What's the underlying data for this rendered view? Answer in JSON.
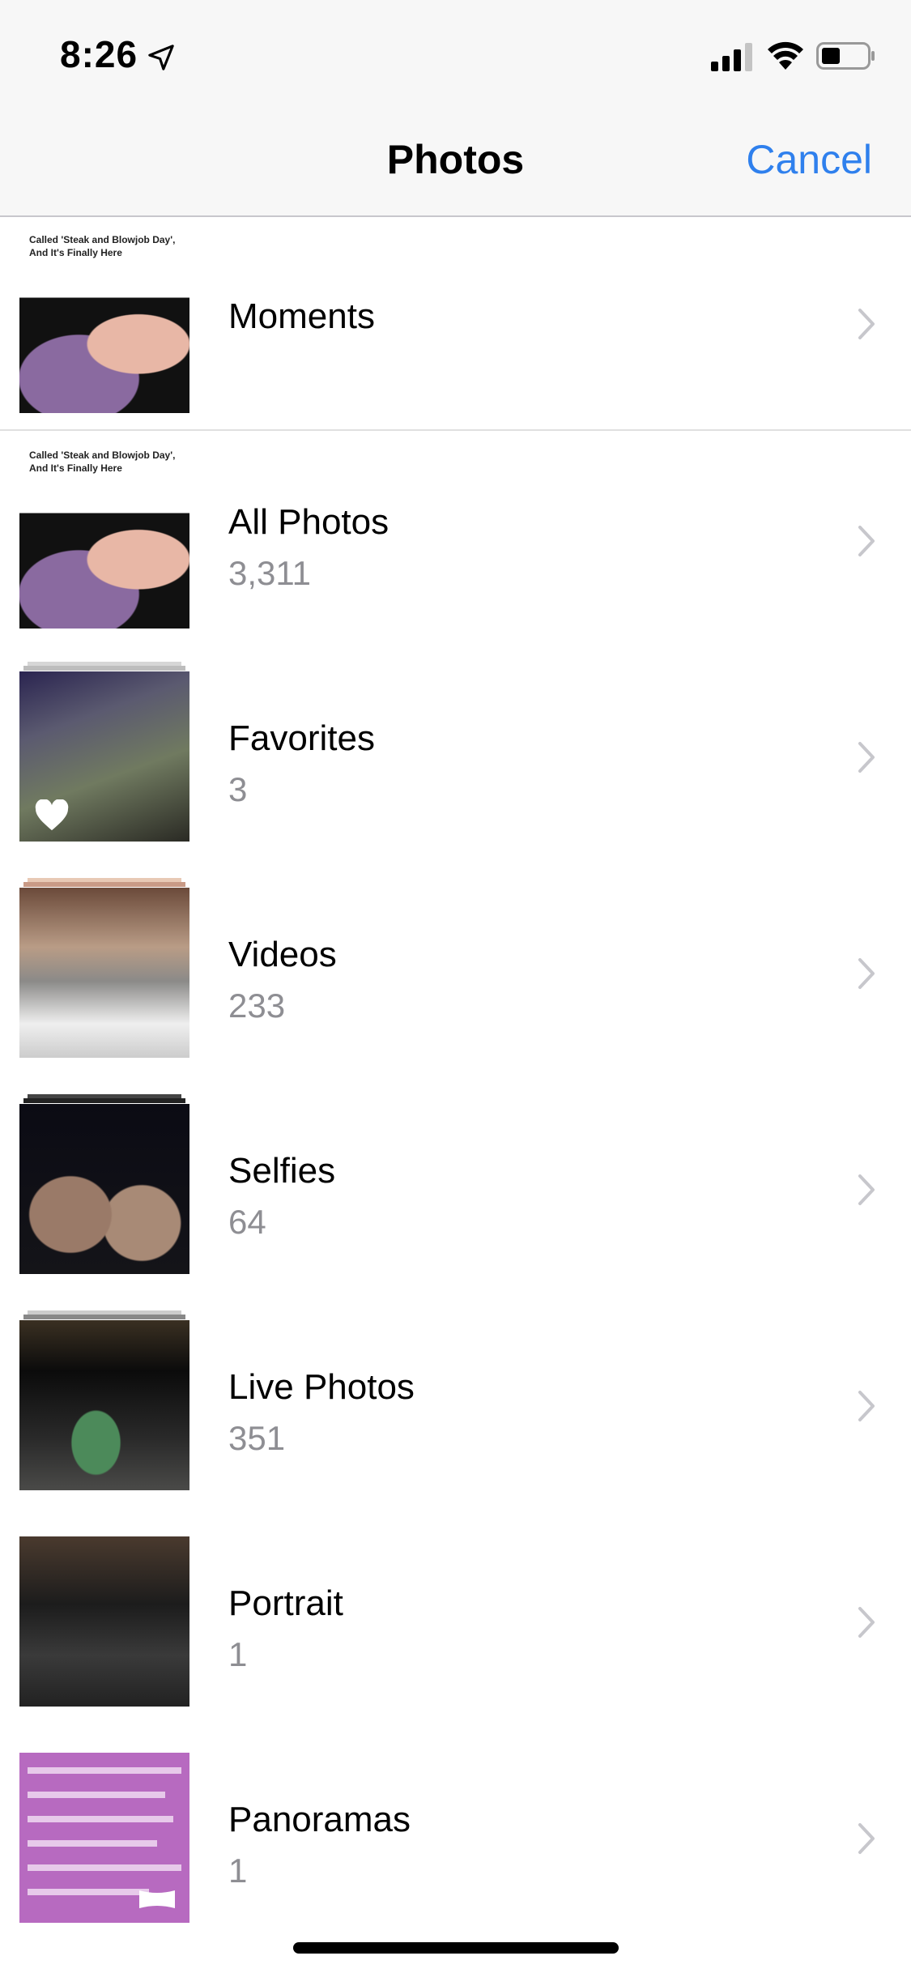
{
  "status_bar": {
    "time": "8:26"
  },
  "nav": {
    "title": "Photos",
    "cancel_label": "Cancel"
  },
  "moments": {
    "title": "Moments",
    "thumb_text": "Called 'Steak and Blowjob Day', And It's Finally Here"
  },
  "albums": [
    {
      "title": "All Photos",
      "count": "3,311",
      "thumb_text": "Called 'Steak and Blowjob Day', And It's Finally Here"
    },
    {
      "title": "Favorites",
      "count": "3"
    },
    {
      "title": "Videos",
      "count": "233"
    },
    {
      "title": "Selfies",
      "count": "64"
    },
    {
      "title": "Live Photos",
      "count": "351"
    },
    {
      "title": "Portrait",
      "count": "1"
    },
    {
      "title": "Panoramas",
      "count": "1"
    }
  ],
  "colors": {
    "accent": "#2f80ed",
    "secondary_text": "#8e8e93"
  },
  "icons": {
    "location": "location-arrow-icon",
    "signal": "cellular-signal-icon",
    "wifi": "wifi-icon",
    "battery": "battery-icon",
    "chevron": "chevron-right-icon",
    "favorite": "heart-icon"
  }
}
